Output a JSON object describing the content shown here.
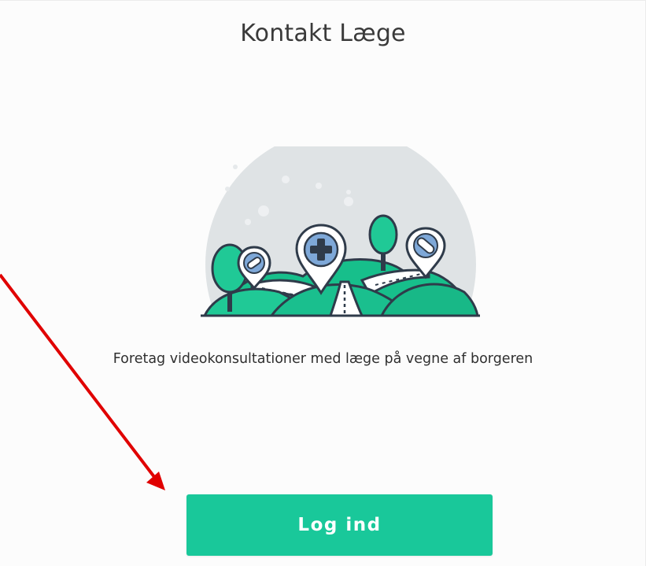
{
  "header": {
    "title": "Kontakt Læge"
  },
  "main": {
    "illustration_icon": "hills-map-pins-medical-illustration",
    "subtitle": "Foretag videokonsultationer med læge på vegne af borgeren",
    "login_label": "Log ind"
  },
  "colors": {
    "accent": "#19c89a",
    "annotation_arrow": "#e00000"
  }
}
